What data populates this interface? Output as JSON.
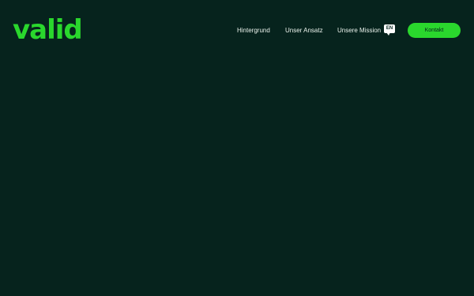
{
  "brand": {
    "logo_text": "valid",
    "accent_color": "#2ad72d",
    "background_color": "#06231d"
  },
  "nav": {
    "items": [
      {
        "label": "Hintergrund"
      },
      {
        "label": "Unser Ansatz"
      },
      {
        "label": "Unsere Mission"
      }
    ],
    "language": {
      "label": "EN",
      "icon": "speech-bubble-icon"
    },
    "contact_label": "Kontakt"
  }
}
